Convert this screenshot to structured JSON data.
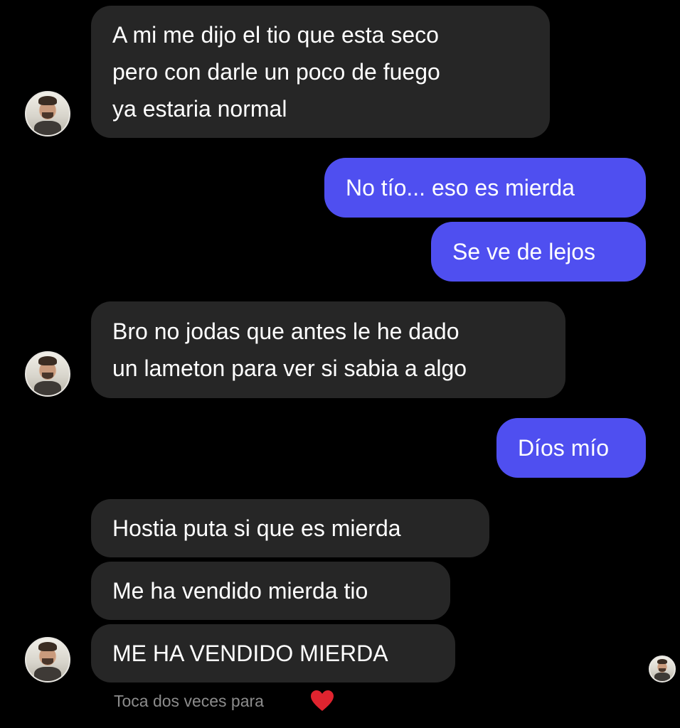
{
  "conversation": {
    "messages": [
      {
        "sender": "contact",
        "lines": [
          "A mi me dijo el tio que esta seco",
          "pero con darle un poco de fuego",
          "ya estaria normal"
        ]
      },
      {
        "sender": "me",
        "lines": [
          "No tío... eso es mierda"
        ]
      },
      {
        "sender": "me",
        "lines": [
          "Se ve de lejos"
        ]
      },
      {
        "sender": "contact",
        "lines": [
          "Bro no jodas que antes le he dado",
          "un lameton para ver si sabia a algo"
        ]
      },
      {
        "sender": "me",
        "lines": [
          "Díos mío"
        ]
      },
      {
        "sender": "contact",
        "lines": [
          "Hostia puta si que es mierda"
        ]
      },
      {
        "sender": "contact",
        "lines": [
          "Me ha vendido mierda tio"
        ]
      },
      {
        "sender": "contact",
        "lines": [
          "ME HA VENDIDO MIERDA"
        ]
      }
    ],
    "double_tap_hint": "Toca dos veces para",
    "hint_icon": "heart-icon",
    "colors": {
      "background": "#000000",
      "incoming_bubble": "#262626",
      "outgoing_bubble": "#4f4ff0",
      "text": "#ffffff",
      "hint_text": "#8c8c8c",
      "heart": "#e0242f"
    },
    "avatars": [
      "contact-avatar",
      "contact-avatar",
      "contact-avatar",
      "read-receipt-avatar"
    ]
  }
}
